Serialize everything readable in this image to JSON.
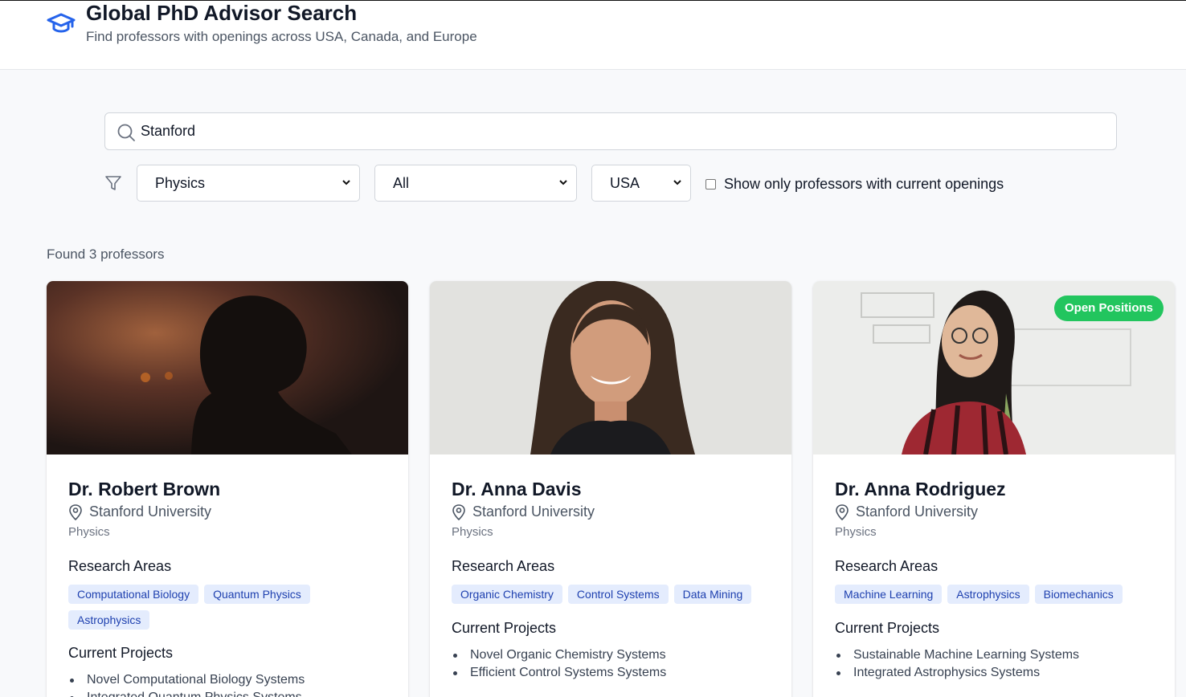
{
  "header": {
    "title": "Global PhD Advisor Search",
    "subtitle": "Find professors with openings across USA, Canada, and Europe"
  },
  "search": {
    "value": "Stanford",
    "icon": "search-icon"
  },
  "filters": {
    "department": "Physics",
    "position": "All",
    "country": "USA",
    "openings_label": "Show only professors with current openings",
    "openings_checked": false
  },
  "results": {
    "count_text": "Found 3 professors"
  },
  "labels": {
    "research_areas": "Research Areas",
    "current_projects": "Current Projects",
    "open_positions": "Open Positions"
  },
  "colors": {
    "accent": "#2563eb",
    "badge_green": "#22c55e",
    "tag_bg": "#e4ecfd",
    "tag_text": "#1e40af"
  },
  "professors": [
    {
      "name": "Dr. Robert Brown",
      "university": "Stanford University",
      "department": "Physics",
      "open_positions": false,
      "research_areas": [
        "Computational Biology",
        "Quantum Physics",
        "Astrophysics"
      ],
      "projects": [
        "Novel Computational Biology Systems",
        "Integrated Quantum Physics Systems"
      ]
    },
    {
      "name": "Dr. Anna Davis",
      "university": "Stanford University",
      "department": "Physics",
      "open_positions": false,
      "research_areas": [
        "Organic Chemistry",
        "Control Systems",
        "Data Mining"
      ],
      "projects": [
        "Novel Organic Chemistry Systems",
        "Efficient Control Systems Systems"
      ]
    },
    {
      "name": "Dr. Anna Rodriguez",
      "university": "Stanford University",
      "department": "Physics",
      "open_positions": true,
      "research_areas": [
        "Machine Learning",
        "Astrophysics",
        "Biomechanics"
      ],
      "projects": [
        "Sustainable Machine Learning Systems",
        "Integrated Astrophysics Systems"
      ]
    }
  ]
}
